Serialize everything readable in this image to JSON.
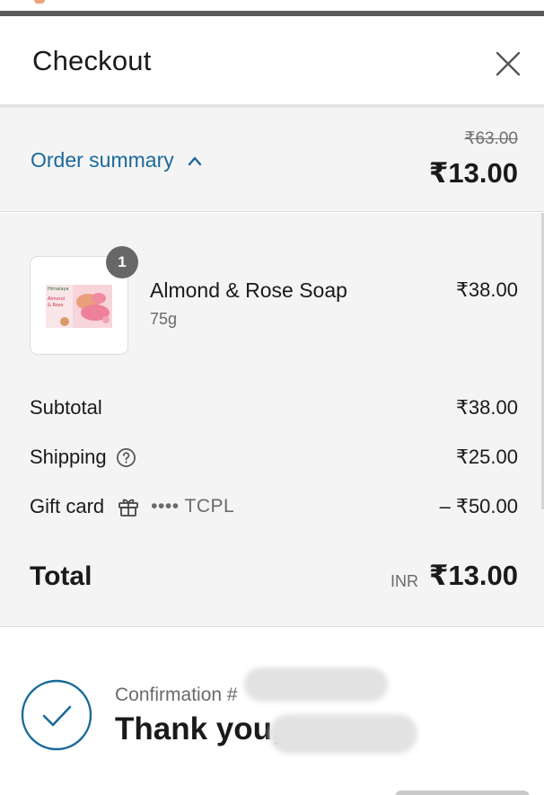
{
  "header": {
    "title": "Checkout",
    "close_icon": "close-icon"
  },
  "order_summary": {
    "toggle_label": "Order summary",
    "toggle_icon": "chevron-up-icon",
    "original_total": "₹63.00",
    "current_total": "₹13.00"
  },
  "items": [
    {
      "name": "Almond & Rose Soap",
      "variant": "75g",
      "price": "₹38.00",
      "quantity": "1",
      "thumbnail": {
        "brand": "Himalaya",
        "product_line_1": "Almond",
        "product_line_2": "& Rose"
      }
    }
  ],
  "lines": {
    "subtotal": {
      "label": "Subtotal",
      "value": "₹38.00"
    },
    "shipping": {
      "label": "Shipping",
      "value": "₹25.00",
      "icon": "help-circle-icon"
    },
    "gift_card": {
      "label": "Gift card",
      "icon": "gift-icon",
      "code": "•••• TCPL",
      "value": "– ₹50.00"
    }
  },
  "total": {
    "label": "Total",
    "currency": "INR",
    "value": "₹13.00"
  },
  "confirmation": {
    "number_prefix": "Confirmation #",
    "thank_you": "Thank you,",
    "icon": "checkmark-circle-icon"
  },
  "colors": {
    "accent": "#1a6a9a",
    "panel_bg": "#f4f4f4",
    "badge_bg": "#676767"
  }
}
